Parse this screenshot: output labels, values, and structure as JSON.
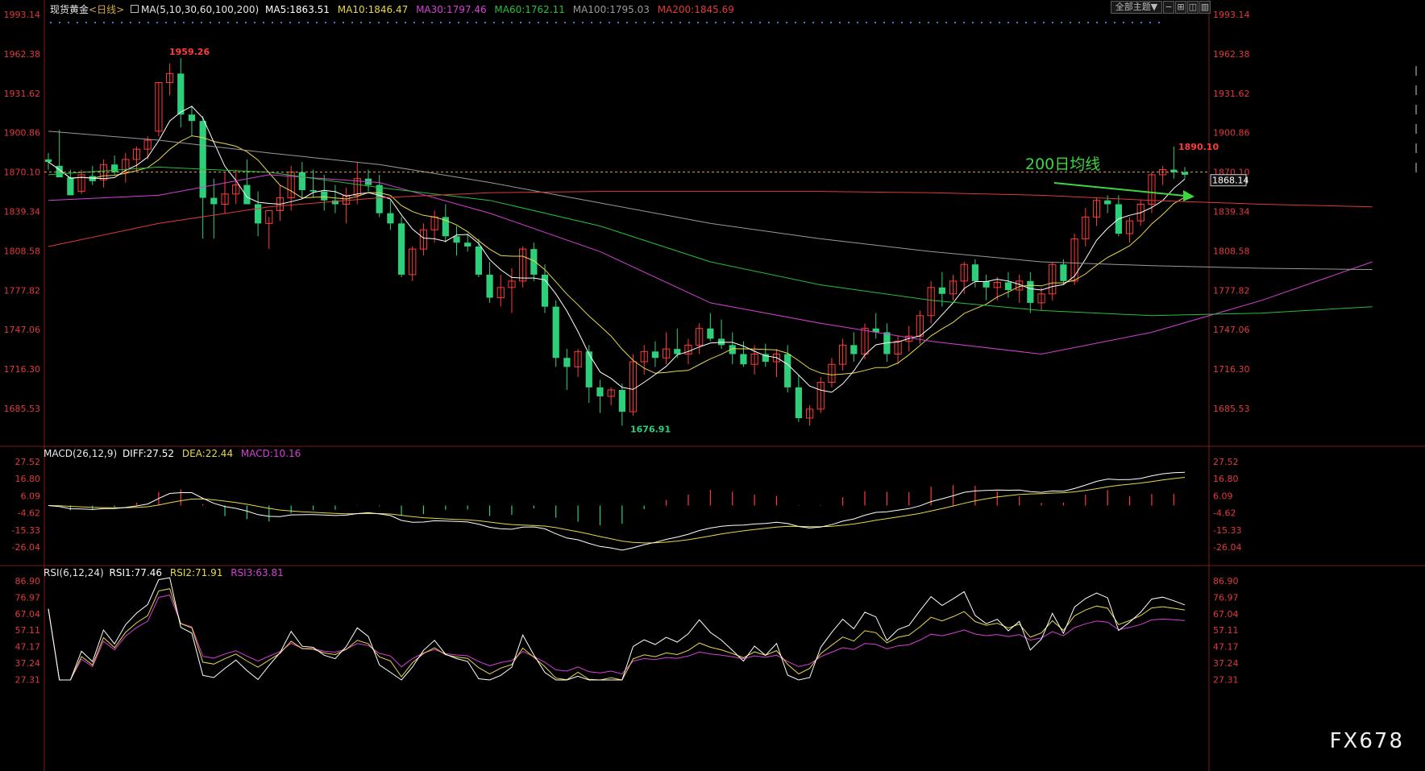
{
  "header": {
    "symbol": "现货黄金",
    "period": "<日线>",
    "ma_params": "MA(5,10,30,60,100,200)",
    "ma5": "MA5:1863.51",
    "ma10": "MA10:1846.47",
    "ma30": "MA30:1797.46",
    "ma60": "MA60:1762.11",
    "ma100": "MA100:1795.03",
    "ma200": "MA200:1845.69"
  },
  "toolbar": {
    "dropdown_label": "全部主题▼"
  },
  "annotation": "200日均线",
  "watermark": "FX678",
  "macd_header": {
    "params": "MACD(26,12,9)",
    "diff": "DIFF:27.52",
    "dea": "DEA:22.44",
    "macd": "MACD:10.16"
  },
  "rsi_header": {
    "params": "RSI(6,12,24)",
    "rsi1": "RSI1:77.46",
    "rsi2": "RSI2:71.91",
    "rsi3": "RSI3:63.81"
  },
  "colors": {
    "up": "#ff3b3b",
    "down": "#2ecf7a",
    "ma5": "#ffffff",
    "ma10": "#e8d84a",
    "ma30": "#d640d6",
    "ma60": "#27c03a",
    "ma100": "#9a9a9a",
    "ma200": "#e03a3a",
    "annotation": "#3ed63e"
  },
  "chart_data": [
    {
      "type": "candlestick",
      "title": "现货黄金 日线",
      "y_ticks": [
        "1993.14",
        "1962.38",
        "1931.62",
        "1900.86",
        "1870.10",
        "1839.34",
        "1808.58",
        "1777.82",
        "1747.06",
        "1716.30",
        "1685.53"
      ],
      "ylim": [
        1670,
        1995
      ],
      "current_price": "1868.14",
      "labels": {
        "high": "1959.26",
        "low": "1676.91",
        "recent_high": "1890.10",
        "ref_line": "1870.10"
      },
      "candles_ohlc": [
        [
          1880,
          1885,
          1872,
          1878
        ],
        [
          1875,
          1903,
          1868,
          1866
        ],
        [
          1866,
          1872,
          1855,
          1852
        ],
        [
          1855,
          1872,
          1853,
          1868
        ],
        [
          1867,
          1875,
          1860,
          1863
        ],
        [
          1864,
          1880,
          1858,
          1876
        ],
        [
          1876,
          1883,
          1868,
          1870
        ],
        [
          1870,
          1885,
          1862,
          1880
        ],
        [
          1880,
          1890,
          1870,
          1888
        ],
        [
          1888,
          1898,
          1880,
          1895
        ],
        [
          1902,
          1940,
          1898,
          1940
        ],
        [
          1940,
          1955,
          1930,
          1947
        ],
        [
          1947,
          1959,
          1905,
          1915
        ],
        [
          1915,
          1922,
          1898,
          1910
        ],
        [
          1910,
          1914,
          1818,
          1850
        ],
        [
          1850,
          1865,
          1818,
          1845
        ],
        [
          1845,
          1870,
          1838,
          1853
        ],
        [
          1853,
          1872,
          1845,
          1860
        ],
        [
          1860,
          1880,
          1852,
          1845
        ],
        [
          1845,
          1855,
          1820,
          1830
        ],
        [
          1830,
          1835,
          1810,
          1840
        ],
        [
          1840,
          1860,
          1832,
          1850
        ],
        [
          1850,
          1875,
          1840,
          1870
        ],
        [
          1870,
          1878,
          1850,
          1856
        ],
        [
          1856,
          1872,
          1850,
          1855
        ],
        [
          1855,
          1868,
          1840,
          1848
        ],
        [
          1848,
          1860,
          1838,
          1845
        ],
        [
          1845,
          1858,
          1830,
          1852
        ],
        [
          1852,
          1878,
          1845,
          1865
        ],
        [
          1865,
          1872,
          1855,
          1860
        ],
        [
          1860,
          1868,
          1835,
          1838
        ],
        [
          1838,
          1848,
          1825,
          1830
        ],
        [
          1830,
          1835,
          1788,
          1790
        ],
        [
          1790,
          1812,
          1785,
          1810
        ],
        [
          1810,
          1830,
          1805,
          1825
        ],
        [
          1825,
          1840,
          1815,
          1835
        ],
        [
          1835,
          1845,
          1815,
          1820
        ],
        [
          1820,
          1828,
          1805,
          1815
        ],
        [
          1815,
          1822,
          1808,
          1812
        ],
        [
          1812,
          1818,
          1788,
          1790
        ],
        [
          1790,
          1800,
          1768,
          1772
        ],
        [
          1772,
          1790,
          1765,
          1780
        ],
        [
          1780,
          1795,
          1760,
          1785
        ],
        [
          1785,
          1812,
          1780,
          1810
        ],
        [
          1810,
          1815,
          1785,
          1790
        ],
        [
          1790,
          1798,
          1760,
          1765
        ],
        [
          1765,
          1770,
          1718,
          1725
        ],
        [
          1725,
          1732,
          1700,
          1718
        ],
        [
          1718,
          1732,
          1710,
          1730
        ],
        [
          1730,
          1735,
          1690,
          1702
        ],
        [
          1702,
          1708,
          1682,
          1695
        ],
        [
          1695,
          1702,
          1688,
          1700
        ],
        [
          1700,
          1705,
          1672,
          1683
        ],
        [
          1683,
          1728,
          1680,
          1722
        ],
        [
          1722,
          1735,
          1712,
          1730
        ],
        [
          1730,
          1738,
          1718,
          1725
        ],
        [
          1725,
          1745,
          1720,
          1732
        ],
        [
          1732,
          1748,
          1725,
          1728
        ],
        [
          1728,
          1740,
          1720,
          1735
        ],
        [
          1735,
          1752,
          1728,
          1748
        ],
        [
          1748,
          1760,
          1738,
          1740
        ],
        [
          1740,
          1755,
          1732,
          1735
        ],
        [
          1735,
          1745,
          1720,
          1728
        ],
        [
          1728,
          1738,
          1718,
          1720
        ],
        [
          1720,
          1735,
          1712,
          1728
        ],
        [
          1728,
          1736,
          1718,
          1722
        ],
        [
          1722,
          1732,
          1710,
          1728
        ],
        [
          1728,
          1735,
          1698,
          1702
        ],
        [
          1702,
          1712,
          1675,
          1678
        ],
        [
          1678,
          1688,
          1672,
          1685
        ],
        [
          1685,
          1710,
          1682,
          1706
        ],
        [
          1706,
          1725,
          1702,
          1720
        ],
        [
          1720,
          1740,
          1715,
          1735
        ],
        [
          1735,
          1745,
          1722,
          1728
        ],
        [
          1728,
          1752,
          1724,
          1748
        ],
        [
          1748,
          1760,
          1740,
          1745
        ],
        [
          1745,
          1752,
          1722,
          1728
        ],
        [
          1728,
          1742,
          1720,
          1738
        ],
        [
          1738,
          1750,
          1730,
          1742
        ],
        [
          1742,
          1762,
          1736,
          1758
        ],
        [
          1758,
          1785,
          1752,
          1780
        ],
        [
          1780,
          1792,
          1765,
          1775
        ],
        [
          1775,
          1790,
          1770,
          1785
        ],
        [
          1785,
          1800,
          1775,
          1798
        ],
        [
          1798,
          1802,
          1780,
          1785
        ],
        [
          1785,
          1790,
          1770,
          1780
        ],
        [
          1780,
          1788,
          1770,
          1784
        ],
        [
          1784,
          1792,
          1772,
          1778
        ],
        [
          1778,
          1790,
          1768,
          1785
        ],
        [
          1785,
          1792,
          1760,
          1768
        ],
        [
          1768,
          1780,
          1762,
          1775
        ],
        [
          1775,
          1800,
          1770,
          1798
        ],
        [
          1798,
          1802,
          1782,
          1785
        ],
        [
          1785,
          1822,
          1782,
          1818
        ],
        [
          1818,
          1842,
          1812,
          1835
        ],
        [
          1835,
          1850,
          1828,
          1848
        ],
        [
          1848,
          1852,
          1838,
          1845
        ],
        [
          1845,
          1852,
          1820,
          1822
        ],
        [
          1822,
          1835,
          1815,
          1832
        ],
        [
          1832,
          1848,
          1828,
          1845
        ],
        [
          1845,
          1870,
          1838,
          1868
        ],
        [
          1868,
          1875,
          1860,
          1872
        ],
        [
          1872,
          1890,
          1865,
          1870
        ],
        [
          1870,
          1874,
          1865,
          1868
        ]
      ]
    },
    {
      "type": "bar+line",
      "title": "MACD(26,12,9)",
      "y_ticks": [
        "27.52",
        "16.80",
        "6.09",
        "-4.62",
        "-15.33",
        "-26.04"
      ],
      "ylim": [
        -31,
        32
      ],
      "diff": 27.52,
      "dea": 22.44,
      "macd": 10.16
    },
    {
      "type": "line",
      "title": "RSI(6,12,24)",
      "y_ticks": [
        "86.90",
        "76.97",
        "67.04",
        "57.11",
        "47.17",
        "37.24",
        "27.31"
      ],
      "ylim": [
        27.31,
        86.9
      ],
      "series": [
        {
          "name": "RSI1",
          "last": 77.46
        },
        {
          "name": "RSI2",
          "last": 71.91
        },
        {
          "name": "RSI3",
          "last": 63.81
        }
      ]
    }
  ]
}
